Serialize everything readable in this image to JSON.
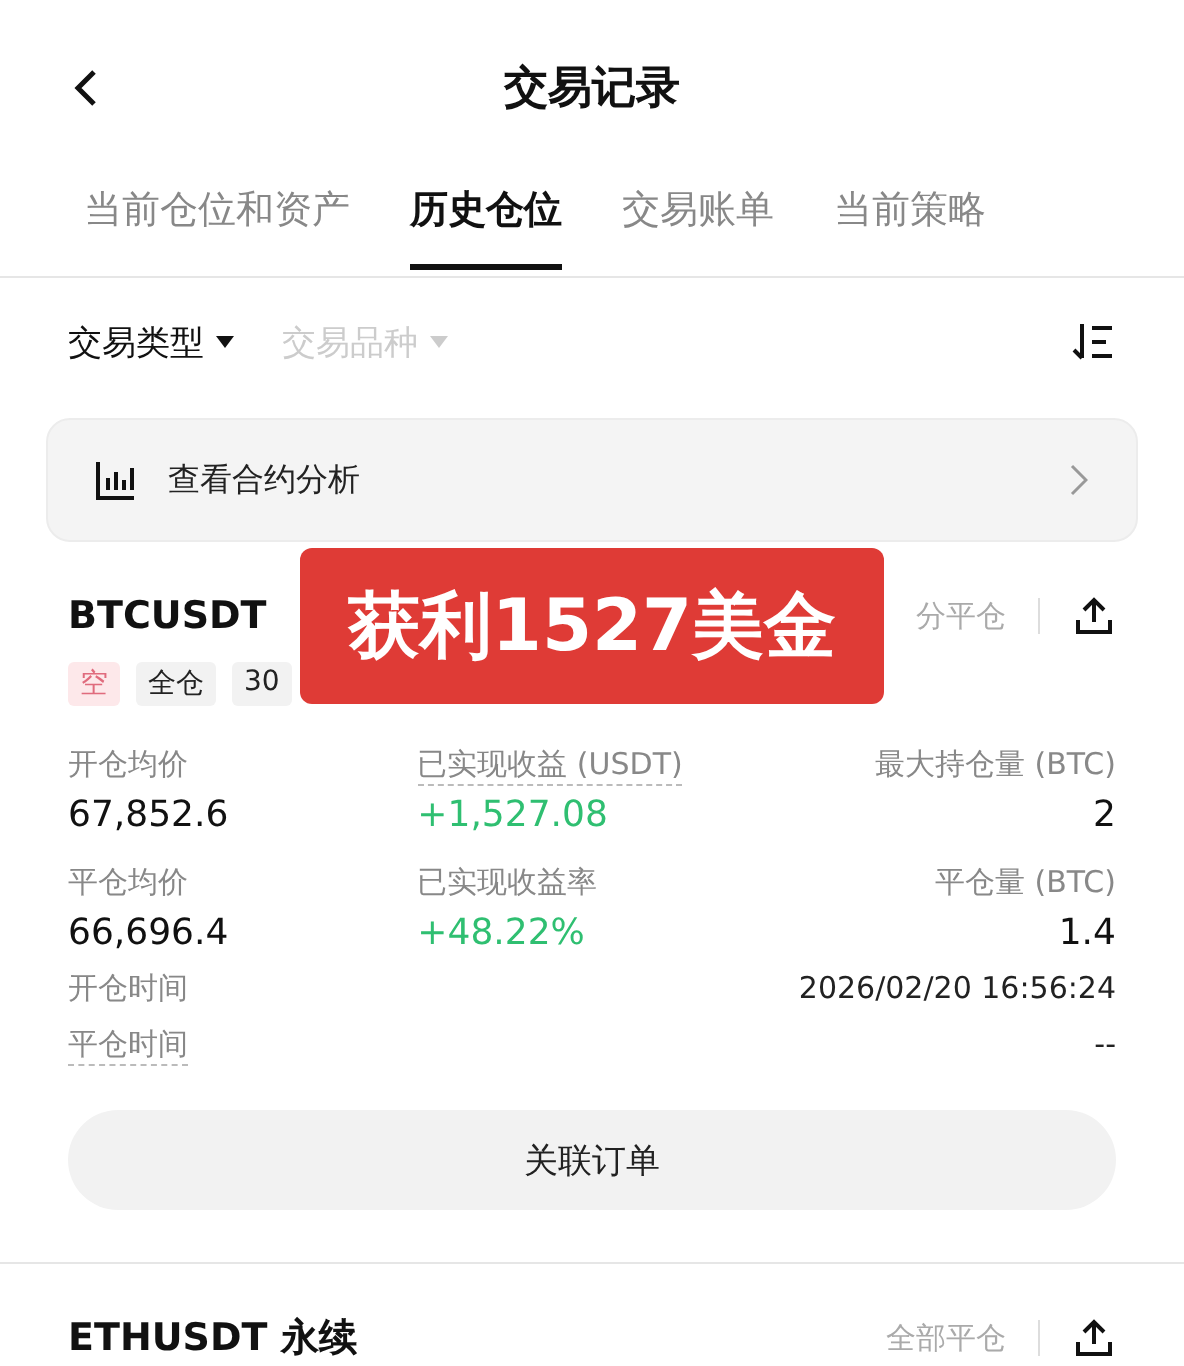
{
  "header": {
    "title": "交易记录"
  },
  "tabs": [
    {
      "label": "当前仓位和资产",
      "selected": false
    },
    {
      "label": "历史仓位",
      "selected": true
    },
    {
      "label": "交易账单",
      "selected": false
    },
    {
      "label": "当前策略",
      "selected": false
    }
  ],
  "filters": [
    {
      "label": "交易类型",
      "disabled": false
    },
    {
      "label": "交易品种",
      "disabled": true
    }
  ],
  "analysis_link": {
    "label": "查看合约分析"
  },
  "position": {
    "symbol": "BTCUSDT",
    "close_action": "分平仓",
    "side": "空",
    "margin_mode": "全仓",
    "leverage": "30",
    "stats": [
      {
        "label": "开仓均价",
        "value": "67,852.6",
        "kind": "plain"
      },
      {
        "label": "已实现收益 (USDT)",
        "value": "+1,527.08",
        "kind": "gain"
      },
      {
        "label": "最大持仓量 (BTC)",
        "value": "2",
        "kind": "plain"
      },
      {
        "label": "平仓均价",
        "value": "66,696.4",
        "kind": "plain"
      },
      {
        "label": "已实现收益率",
        "value": "+48.22%",
        "kind": "gain"
      },
      {
        "label": "平仓量 (BTC)",
        "value": "1.4",
        "kind": "plain"
      }
    ],
    "times": [
      {
        "label": "开仓时间",
        "value": "2026/02/20 16:56:24"
      },
      {
        "label": "平仓时间",
        "value": "--"
      }
    ],
    "button": "关联订单"
  },
  "next_position": {
    "symbol": "ETHUSDT 永续",
    "close_action": "全部平仓"
  },
  "banner": {
    "text": "获利1527美金"
  }
}
